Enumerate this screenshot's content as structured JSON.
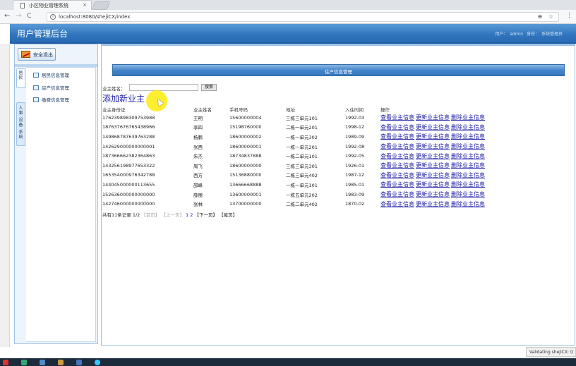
{
  "browser": {
    "tab_title": "小区物业管理系统",
    "tab_close": "×",
    "url": "localhost:8080/shejiCX/index",
    "back": "←",
    "forward": "→",
    "reload": "C",
    "url_actions": "⊕ ☆",
    "menu": "⋮"
  },
  "header": {
    "title": "用户管理后台",
    "user_label": "用户：",
    "user_name": "admin",
    "role_label": "身份：",
    "role_name": "系统管理员"
  },
  "sidebar": {
    "logout_label": "安全退出",
    "vertical_tabs": [
      "居民",
      "人事",
      "设备",
      "系统"
    ],
    "items": [
      {
        "label": "居民信息管理"
      },
      {
        "label": "房产信息管理"
      },
      {
        "label": "缴费信息管理"
      }
    ]
  },
  "main": {
    "panel_title": "住户信息管理",
    "search_label": "业主姓名：",
    "search_value": "",
    "search_button": "搜索",
    "add_link": "添加新业主",
    "columns": [
      "业主身份证",
      "业主姓名",
      "手机号码",
      "地址",
      "入住时间",
      "操作"
    ],
    "actions": [
      "查看业主信息",
      "更新业主信息",
      "删除业主信息"
    ],
    "rows": [
      {
        "id": "176239898309753988",
        "name": "王明",
        "phone": "15600000004",
        "addr": "三栋三单元101",
        "date": "1992-03"
      },
      {
        "id": "187637676765438966",
        "name": "李四",
        "phone": "15198760000",
        "addr": "二栋一单元201",
        "date": "1998-12"
      },
      {
        "id": "149868787639763288",
        "name": "杨鹏",
        "phone": "18600000002",
        "addr": "一栋一单元302",
        "date": "1989-09"
      },
      {
        "id": "142629000000000001",
        "name": "张西",
        "phone": "18600000001",
        "addr": "一栋一单元201",
        "date": "1992-08"
      },
      {
        "id": "187366662382364863",
        "name": "朱杰",
        "phone": "18734837888",
        "addr": "一栋二单元101",
        "date": "1992-05"
      },
      {
        "id": "143256198977653322",
        "name": "周飞",
        "phone": "18600000000",
        "addr": "三栋三单元301",
        "date": "1926-01"
      },
      {
        "id": "165354000976342788",
        "name": "西方",
        "phone": "15136880000",
        "addr": "二栋三单元402",
        "date": "1987-12"
      },
      {
        "id": "144045000000113655",
        "name": "邵峰",
        "phone": "13666668888",
        "addr": "一栋一单元101",
        "date": "1985-01"
      },
      {
        "id": "152636000000000000",
        "name": "薛丽",
        "phone": "13600000001",
        "addr": "一栋五单元202",
        "date": "1983-09"
      },
      {
        "id": "142746000000000000",
        "name": "张林",
        "phone": "13700000000",
        "addr": "二栋二单元402",
        "date": "1870-02"
      }
    ],
    "pager": {
      "summary": "共有11条记录 1/2",
      "first": "【首页】",
      "prev": "【上一页】",
      "page1": "1",
      "page2": "2",
      "next": "【下一页】",
      "last": "【尾页】"
    }
  },
  "status": {
    "text": "Validating shejiCX: (("
  }
}
